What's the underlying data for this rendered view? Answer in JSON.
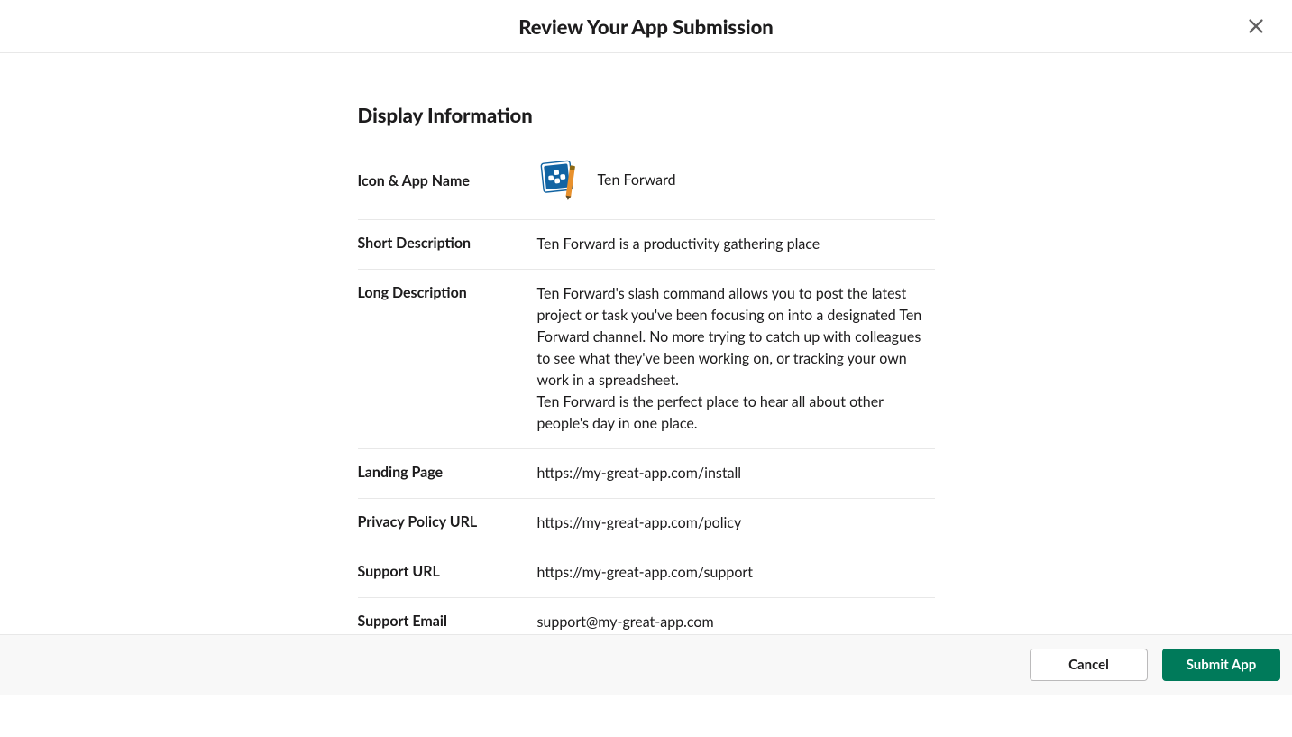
{
  "header": {
    "title": "Review Your App Submission"
  },
  "section": {
    "title": "Display Information"
  },
  "fields": {
    "iconAppName": {
      "label": "Icon & App Name",
      "appName": "Ten Forward"
    },
    "shortDescription": {
      "label": "Short Description",
      "value": "Ten Forward is a productivity gathering place"
    },
    "longDescription": {
      "label": "Long Description",
      "value1": "Ten Forward's slash command allows you to post the latest project or task you've been focusing on into a designated Ten Forward channel. No more trying to catch up with colleagues to see what they've been working on, or tracking your own work in a spreadsheet.",
      "value2": "Ten Forward is the perfect place to hear all about other people's day in one place."
    },
    "landingPage": {
      "label": "Landing Page",
      "value": "https://my-great-app.com/install"
    },
    "privacyPolicy": {
      "label": "Privacy Policy URL",
      "value": "https://my-great-app.com/policy"
    },
    "supportUrl": {
      "label": "Support URL",
      "value": "https://my-great-app.com/support"
    },
    "supportEmail": {
      "label": "Support Email",
      "value": "support@my-great-app.com"
    }
  },
  "footer": {
    "cancel": "Cancel",
    "submit": "Submit App"
  }
}
